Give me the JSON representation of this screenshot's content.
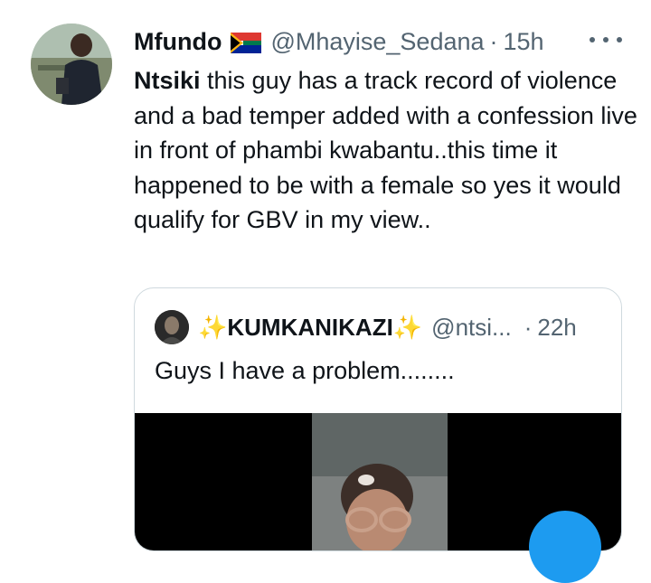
{
  "tweet": {
    "author_name": "Mfundo",
    "handle": "@Mhayise_Sedana",
    "separator": "·",
    "time": "15h",
    "mention": "Ntsiki",
    "text": " this guy has a track record of violence and a bad temper added with  a confession live in front of phambi kwabantu..this time it happened to be with a female so yes it would qualify for GBV in my view..",
    "flag_icon": "south-africa-flag-icon",
    "more_icon": "more-options-icon"
  },
  "quote": {
    "sparkle_left": "✨",
    "author_name": "KUMKANIKAZI",
    "sparkle_right": "✨",
    "handle": "@ntsi...",
    "separator": "·",
    "time": "22h",
    "text": "Guys I have a problem........"
  },
  "colors": {
    "text_primary": "#0f1419",
    "text_secondary": "#536471",
    "border": "#cfd9de",
    "accent": "#1d9bf0"
  }
}
